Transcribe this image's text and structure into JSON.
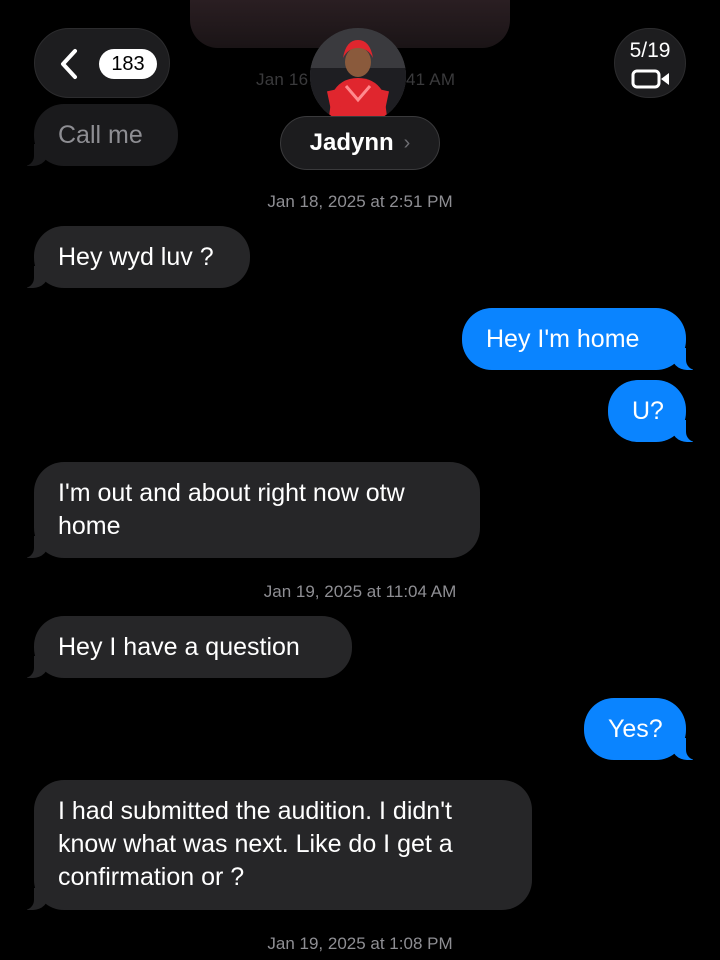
{
  "header": {
    "back_count": "183",
    "page_counter": "5/19",
    "contact_name": "Jadynn",
    "contact_chevron": "›",
    "ghost_timestamp_left": "Jan 16",
    "ghost_timestamp_right": "41 AM",
    "icons": {
      "back": "chevron-left-icon",
      "video": "video-camera-icon",
      "contact_chevron": "chevron-right-icon"
    }
  },
  "colors": {
    "background": "#000000",
    "incoming_bubble": "#262628",
    "outgoing_bubble": "#0a84ff",
    "timestamp_text": "#8e8e93",
    "badge_bg": "#ffffff"
  },
  "messages": [
    {
      "direction": "in",
      "text": "Call me",
      "faded": true
    },
    {
      "type": "timestamp",
      "text": "Jan 18, 2025 at 2:51 PM"
    },
    {
      "direction": "in",
      "text": "Hey wyd luv ?"
    },
    {
      "direction": "out",
      "text": "Hey I'm home"
    },
    {
      "direction": "out",
      "text": "U?"
    },
    {
      "direction": "in",
      "text": "I'm out and about right now otw home"
    },
    {
      "type": "timestamp",
      "text": "Jan 19, 2025 at 11:04 AM"
    },
    {
      "direction": "in",
      "text": "Hey I have a question"
    },
    {
      "direction": "out",
      "text": "Yes?"
    },
    {
      "direction": "in",
      "text": "I had submitted the audition. I didn't know what was next. Like do I get a confirmation or ?"
    },
    {
      "type": "timestamp",
      "text": "Jan 19, 2025 at 1:08 PM"
    }
  ]
}
